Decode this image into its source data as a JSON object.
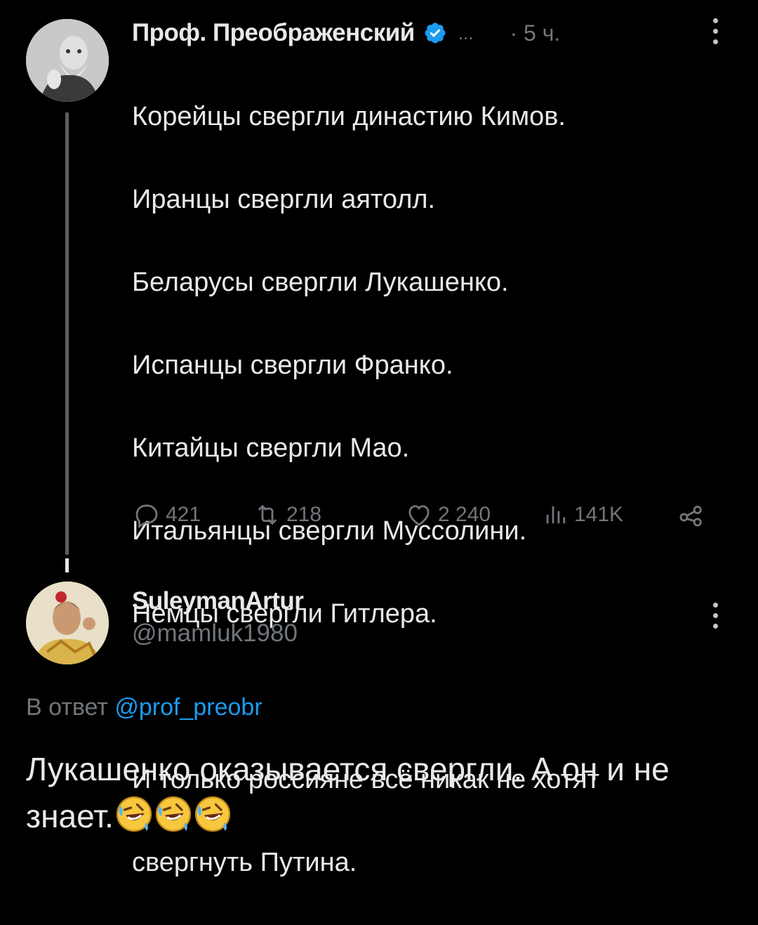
{
  "tweet": {
    "author_name": "Проф. Преображенский",
    "verified_icon": "verified-badge-icon",
    "separator": "...",
    "time": "· 5 ч.",
    "lines": [
      "Корейцы свергли династию Кимов.",
      "Иранцы свергли аятолл.",
      "Беларусы свергли Лукашенко.",
      "Испанцы свергли Франко.",
      "Китайцы свергли Мао.",
      "Итальянцы свергли Муссолини.",
      "Немцы свергли Гитлера.",
      "",
      "И только россияне всё никак не хотят",
      "свергнуть Путина."
    ],
    "actions": {
      "replies": "421",
      "retweets": "218",
      "likes": "2 240",
      "views": "141K"
    }
  },
  "reply": {
    "author_name": "SuleymanArtur",
    "handle": "@mamluk1980",
    "reply_to_prefix": "В ответ",
    "reply_to_mention": "@prof_preobr",
    "text": "Лукашенко оказывается свергли. А он и не знает.",
    "emojis": [
      "rolling-on-floor-laughing",
      "rolling-on-floor-laughing",
      "rolling-on-floor-laughing"
    ]
  },
  "colors": {
    "background": "#000000",
    "text": "#e7e9ea",
    "muted": "#71767b",
    "accent": "#1d9bf0"
  }
}
